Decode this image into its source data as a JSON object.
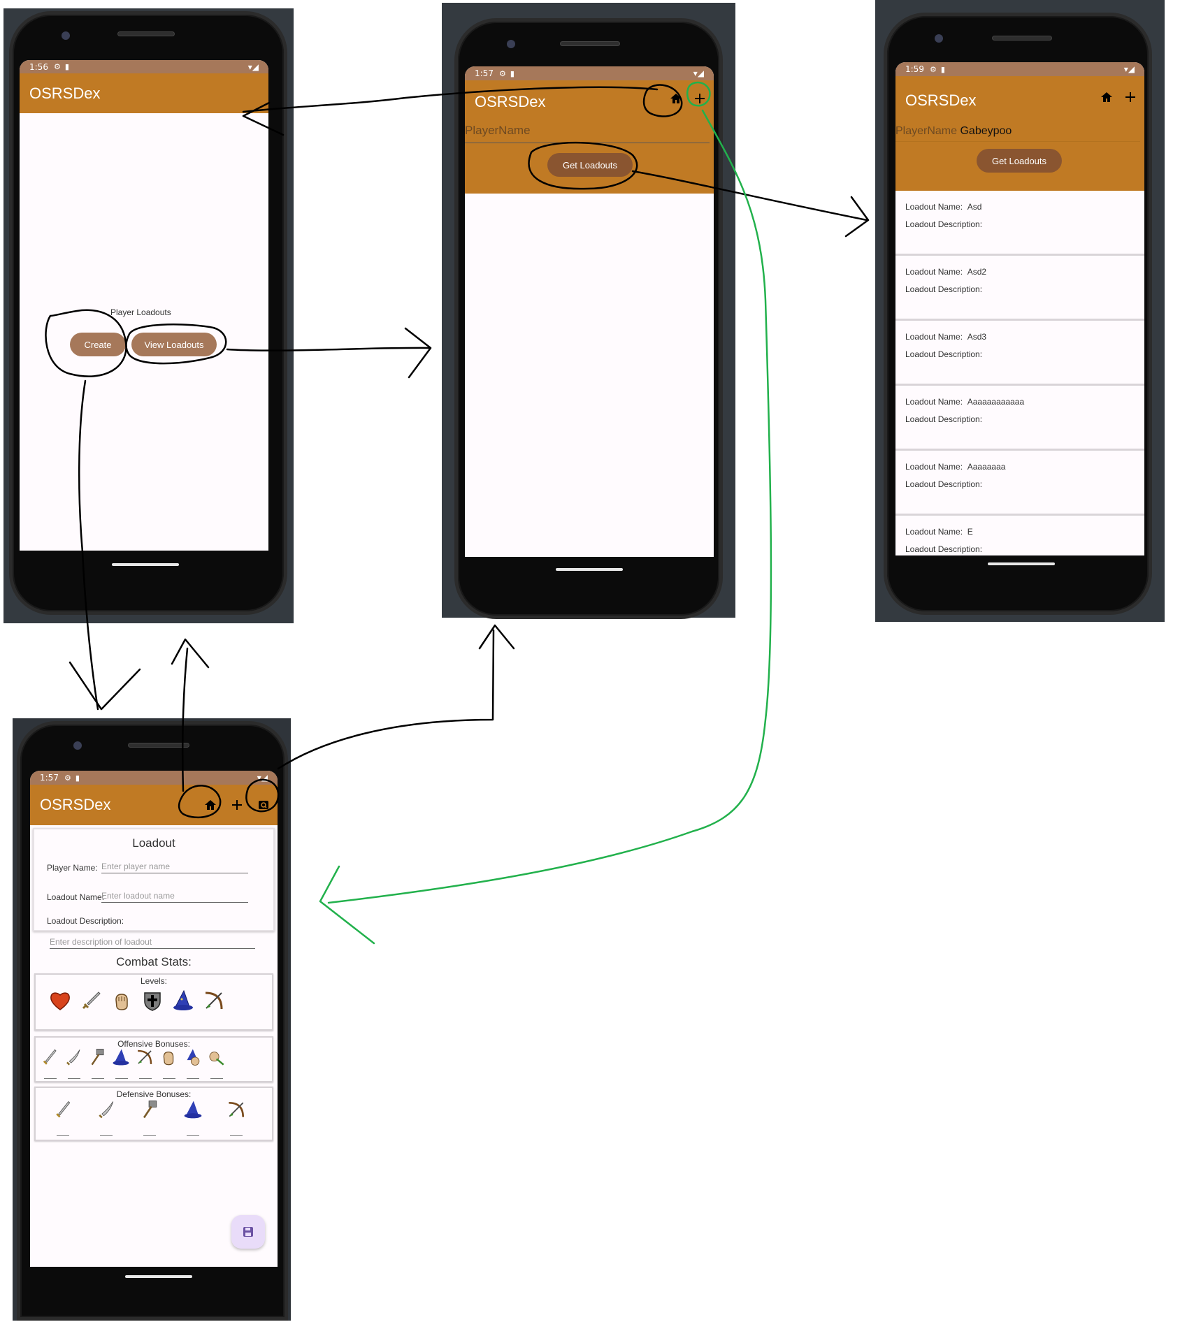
{
  "app": {
    "title": "OSRSDex",
    "accent": "#c07a24",
    "status_bar_color": "#a6785a",
    "button_color": "#a6785a"
  },
  "screen_home": {
    "status_time": "1:56",
    "section_label": "Player Loadouts",
    "create_button": "Create",
    "view_button": "View Loadouts"
  },
  "screen_search": {
    "status_time": "1:57",
    "player_name_placeholder": "PlayerName",
    "get_button": "Get Loadouts",
    "icons": [
      "home-icon",
      "add-icon"
    ]
  },
  "screen_results": {
    "status_time": "1:59",
    "player_name_label": "PlayerName",
    "player_name_value": "Gabeypoo",
    "get_button": "Get Loadouts",
    "name_label": "Loadout Name:",
    "desc_label": "Loadout Description:",
    "loadouts": [
      {
        "name": "Asd"
      },
      {
        "name": "Asd2"
      },
      {
        "name": "Asd3"
      },
      {
        "name": "Aaaaaaaaaaaa"
      },
      {
        "name": "Aaaaaaaa"
      },
      {
        "name": "E"
      }
    ]
  },
  "screen_create": {
    "status_time": "1:57",
    "card_title": "Loadout",
    "player_name_label": "Player Name:",
    "player_name_placeholder": "Enter player name",
    "loadout_name_label": "Loadout Name:",
    "loadout_name_placeholder": "Enter loadout name",
    "description_label": "Loadout Description:",
    "description_placeholder": "Enter description of loadout",
    "combat_title": "Combat Stats:",
    "levels_label": "Levels:",
    "offensive_label": "Offensive Bonuses:",
    "defensive_label": "Defensive Bonuses:",
    "level_icons": [
      "hitpoints-icon",
      "attack-icon",
      "strength-icon",
      "defence-icon",
      "magic-icon",
      "ranged-icon"
    ],
    "offensive_icons": [
      "stab-icon",
      "slash-icon",
      "crush-icon",
      "magic-icon",
      "ranged-icon",
      "strength-icon",
      "magic-strength-icon",
      "ranged-strength-icon"
    ],
    "defensive_icons": [
      "stab-icon",
      "slash-icon",
      "crush-icon",
      "magic-icon",
      "ranged-icon"
    ],
    "fab_icon": "save-icon"
  },
  "annotations": {
    "ink_color": "#000000",
    "green_color": "#22b14c"
  }
}
